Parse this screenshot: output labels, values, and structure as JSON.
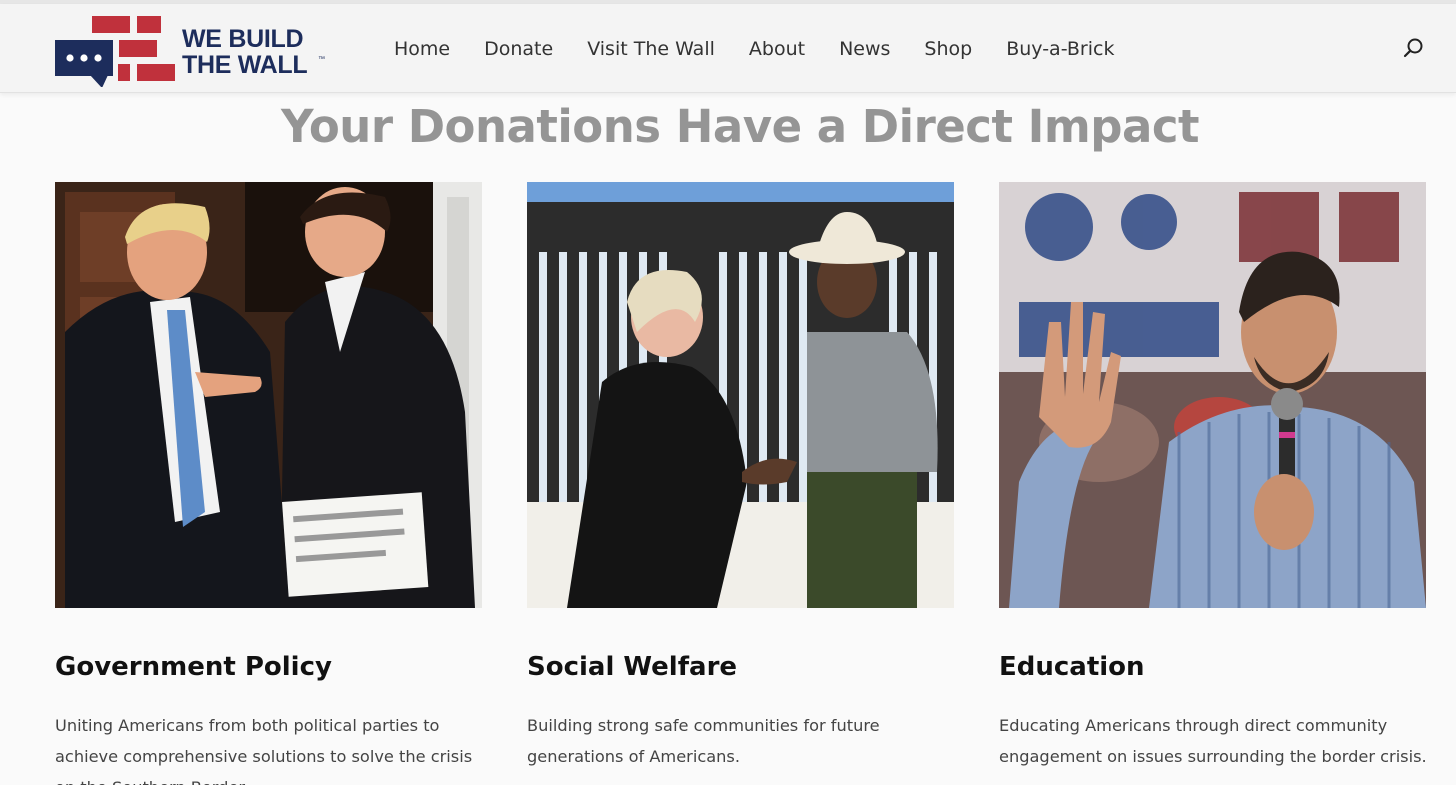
{
  "brand": {
    "logo_line1": "WE BUILD",
    "logo_line2": "THE WALL",
    "logo_tm": "™",
    "colors": {
      "navy": "#1d2d5c",
      "red": "#c0313c"
    }
  },
  "nav": {
    "items": [
      {
        "label": "Home"
      },
      {
        "label": "Donate"
      },
      {
        "label": "Visit The Wall"
      },
      {
        "label": "About"
      },
      {
        "label": "News"
      },
      {
        "label": "Shop"
      },
      {
        "label": "Buy-a-Brick"
      }
    ],
    "search_icon": "search-icon"
  },
  "main": {
    "heading": "Your Donations Have a Direct Impact",
    "cards": [
      {
        "title": "Government Policy",
        "text": "Uniting Americans from both political parties to achieve comprehensive solutions to solve the crisis on the Southern Border.",
        "photo_icon": "photo-two-men-in-suits"
      },
      {
        "title": "Social Welfare",
        "text": "Building strong safe communities for future generations of Americans.",
        "photo_icon": "photo-handshake-at-border-wall"
      },
      {
        "title": "Education",
        "text": "Educating Americans through direct community engagement on issues surrounding the border crisis.",
        "photo_icon": "photo-man-speaking-with-microphone"
      }
    ]
  }
}
